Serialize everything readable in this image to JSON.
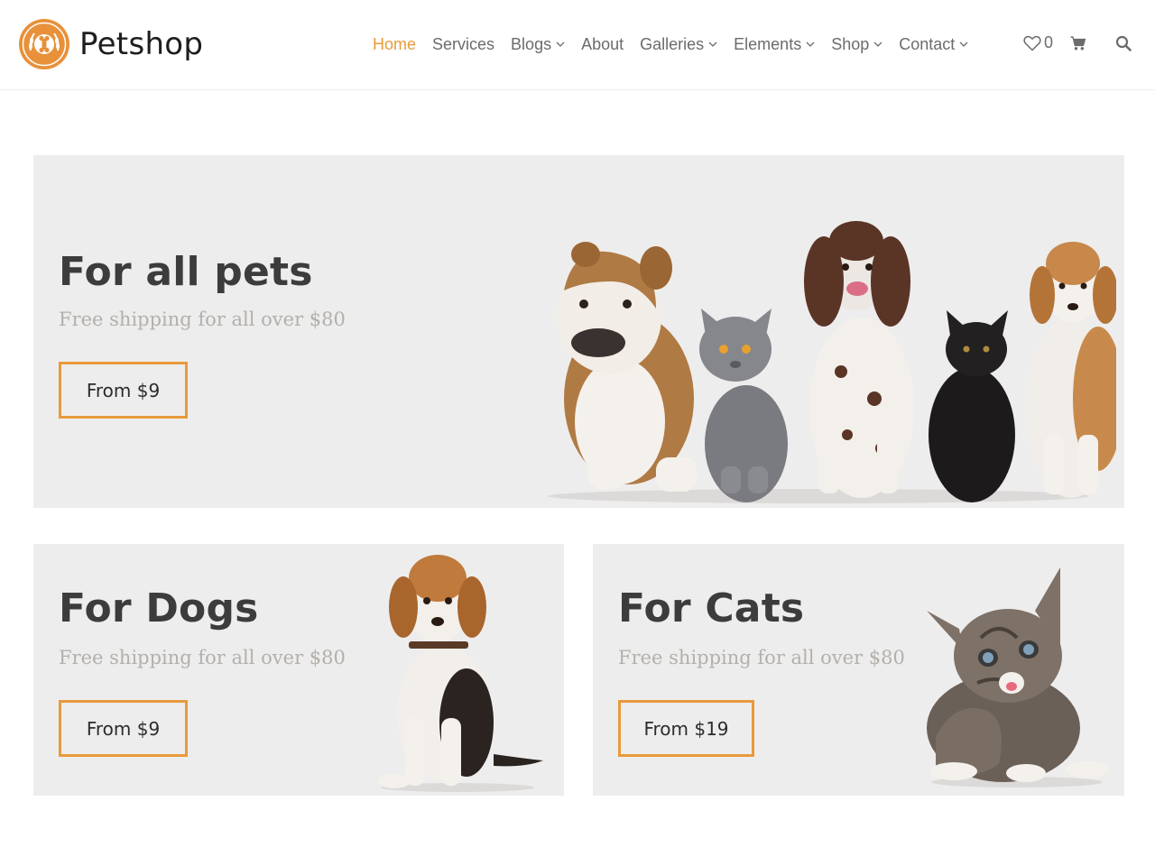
{
  "brand": {
    "name": "Petshop"
  },
  "nav": {
    "items": [
      {
        "label": "Home",
        "active": true,
        "dropdown": false
      },
      {
        "label": "Services",
        "active": false,
        "dropdown": false
      },
      {
        "label": "Blogs",
        "active": false,
        "dropdown": true
      },
      {
        "label": "About",
        "active": false,
        "dropdown": false
      },
      {
        "label": "Galleries",
        "active": false,
        "dropdown": true
      },
      {
        "label": "Elements",
        "active": false,
        "dropdown": true
      },
      {
        "label": "Shop",
        "active": false,
        "dropdown": true
      },
      {
        "label": "Contact",
        "active": false,
        "dropdown": true
      }
    ]
  },
  "actions": {
    "wishlist_count": "0",
    "icons": [
      "heart-icon",
      "cart-icon",
      "search-icon"
    ]
  },
  "banners": {
    "main": {
      "title": "For all pets",
      "subtitle": "Free shipping for all over $80",
      "button": "From $9"
    },
    "dogs": {
      "title": "For Dogs",
      "subtitle": "Free shipping for all over $80",
      "button": "From $9"
    },
    "cats": {
      "title": "For Cats",
      "subtitle": "Free shipping for all over $80",
      "button": "From $19"
    }
  },
  "colors": {
    "accent": "#e89a3c",
    "nav_text": "#6b6b6b",
    "banner_bg": "#eeeded",
    "heading": "#3c3c3c",
    "subtitle": "#b3b0ab"
  }
}
